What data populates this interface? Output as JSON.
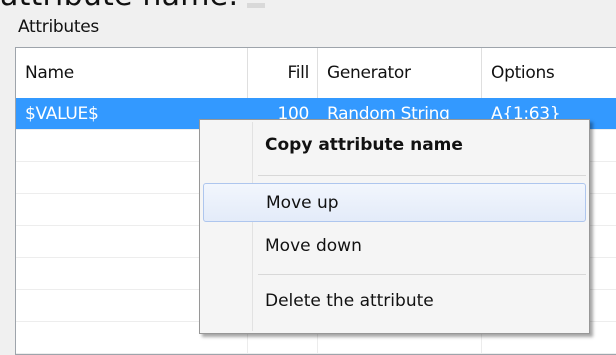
{
  "page": {
    "top_text": "attribute name:"
  },
  "attributes": {
    "group_label": "Attributes",
    "columns": [
      {
        "label": "Name"
      },
      {
        "label": "Fill"
      },
      {
        "label": "Generator"
      },
      {
        "label": "Options"
      }
    ],
    "rows": [
      {
        "name": "$VALUE$",
        "fill": "100",
        "generator": "Random String",
        "options": "A{1:63}",
        "selected": true
      }
    ]
  },
  "context_menu": {
    "items": [
      {
        "label": "Copy attribute name",
        "bold": true
      },
      {
        "label": "Move up",
        "hovered": true
      },
      {
        "label": "Move down"
      },
      {
        "label": "Delete the attribute"
      }
    ]
  },
  "colors": {
    "selection": "#3399ff",
    "menu_hover_border": "#aec6ee"
  }
}
